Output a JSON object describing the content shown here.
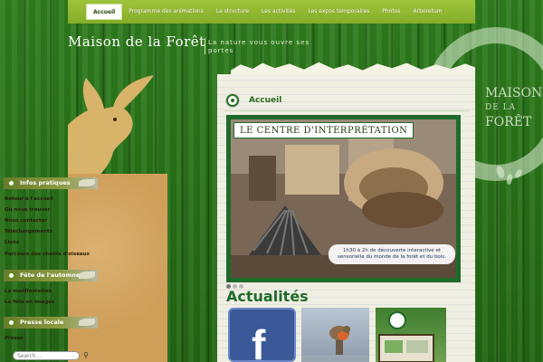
{
  "nav": {
    "items": [
      {
        "label": "Accueil",
        "active": true
      },
      {
        "label": "Programme des animations"
      },
      {
        "label": "La structure"
      },
      {
        "label": "Les activités"
      },
      {
        "label": "Les expos temporaires"
      },
      {
        "label": "Photos"
      },
      {
        "label": "Arboretum"
      }
    ]
  },
  "header": {
    "site_title": "Maison de la Forêt",
    "tagline": "La nature vous ouvre ses portes"
  },
  "logo": {
    "line1": "MAISON",
    "line2": "DE LA",
    "line3": "FORÊT"
  },
  "sidebar": {
    "sections": [
      {
        "title": "Infos pratiques",
        "links": [
          "Retour à l'accueil",
          "Où nous trouver",
          "Nous contacter",
          "Téléchargements",
          "Liens",
          "Parcours des chants d'oiseaux"
        ]
      },
      {
        "title": "Fête de l'automne",
        "links": [
          "La manifestation",
          "La fête en images"
        ]
      },
      {
        "title": "Presse locale",
        "links": [
          "Presse"
        ]
      }
    ],
    "search_placeholder": "Search..."
  },
  "content": {
    "title": "Accueil",
    "slide_banner": "LE CENTRE D'INTERPRÉTATION",
    "slide_caption": "1h30 à 2h de découverte interactive et sensorielle du monde de la forêt et du bois.",
    "news_title": "Actualités",
    "facebook_letter": "f"
  },
  "colors": {
    "nav_green": "#9dc43b",
    "brand_green": "#1f6a2a",
    "sidebar_tan": "#cf9f5a",
    "paper": "#efeee2"
  }
}
